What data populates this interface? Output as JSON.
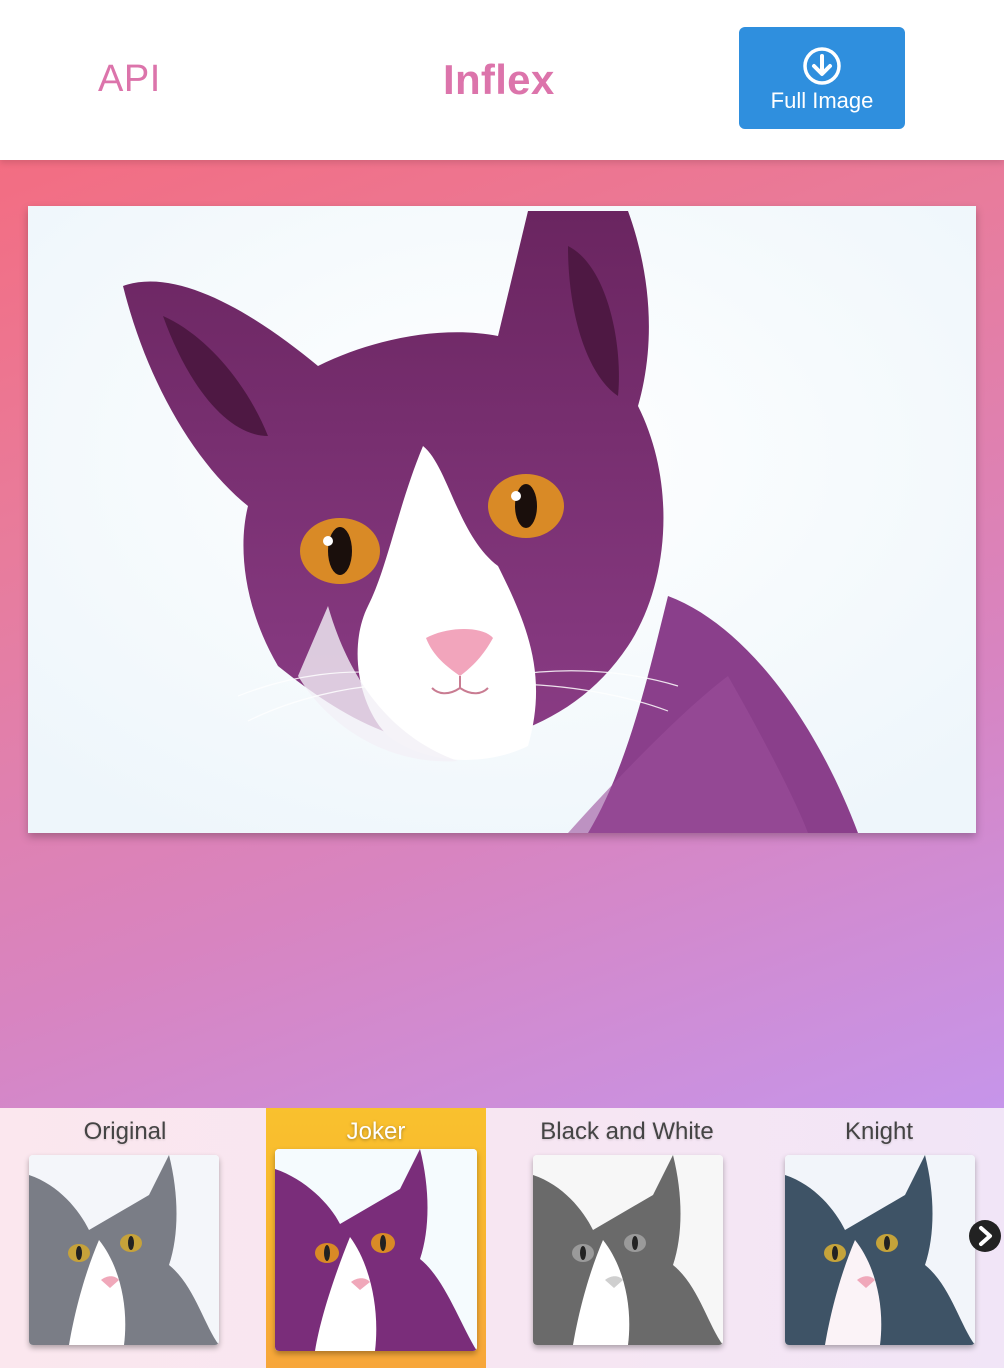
{
  "header": {
    "api_label": "API",
    "brand": "Inflex",
    "full_image_label": "Full Image"
  },
  "main_image": {
    "filter": "Joker",
    "icon": "cat-photo"
  },
  "filters": [
    {
      "label": "Original",
      "active": false
    },
    {
      "label": "Joker",
      "active": true
    },
    {
      "label": "Black and White",
      "active": false
    },
    {
      "label": "Knight",
      "active": false
    }
  ],
  "colors": {
    "brand_pink": "#dc74ab",
    "button_blue": "#2f8fde",
    "active_filter": "#f8b52f"
  }
}
